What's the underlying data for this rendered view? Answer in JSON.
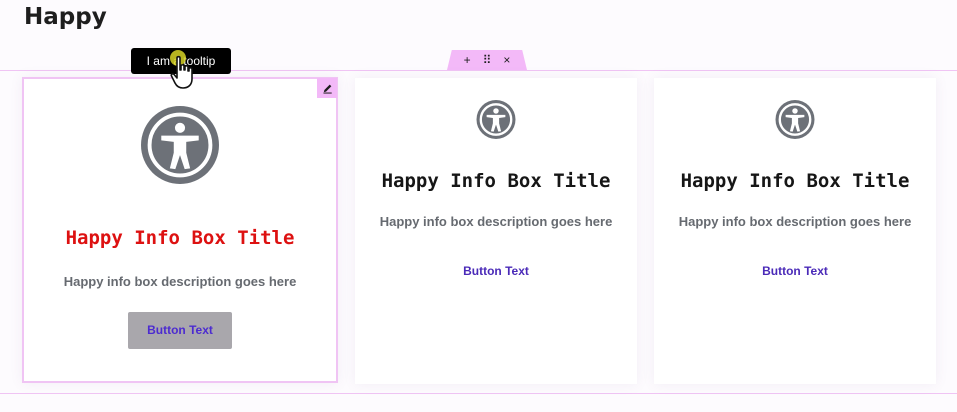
{
  "header": {
    "title": "Happy"
  },
  "handle": {
    "add": "+",
    "move": "⠿",
    "close": "×"
  },
  "tooltip": {
    "text": "I am a tooltip"
  },
  "colors": {
    "accent_pink": "#f3b9f8",
    "title_red": "#dd1111",
    "icon_gray": "#6d7178",
    "button_text": "#4c2bd0",
    "button_bg": "#a9a7ac"
  },
  "cards": [
    {
      "icon": "accessibility-icon",
      "title": "Happy Info Box Title",
      "description": "Happy info box description goes here",
      "button": "Button Text"
    },
    {
      "icon": "accessibility-icon",
      "title": "Happy Info Box Title",
      "description": "Happy info box description goes here",
      "button": "Button Text"
    },
    {
      "icon": "accessibility-icon",
      "title": "Happy Info Box Title",
      "description": "Happy info box description goes here",
      "button": "Button Text"
    }
  ]
}
